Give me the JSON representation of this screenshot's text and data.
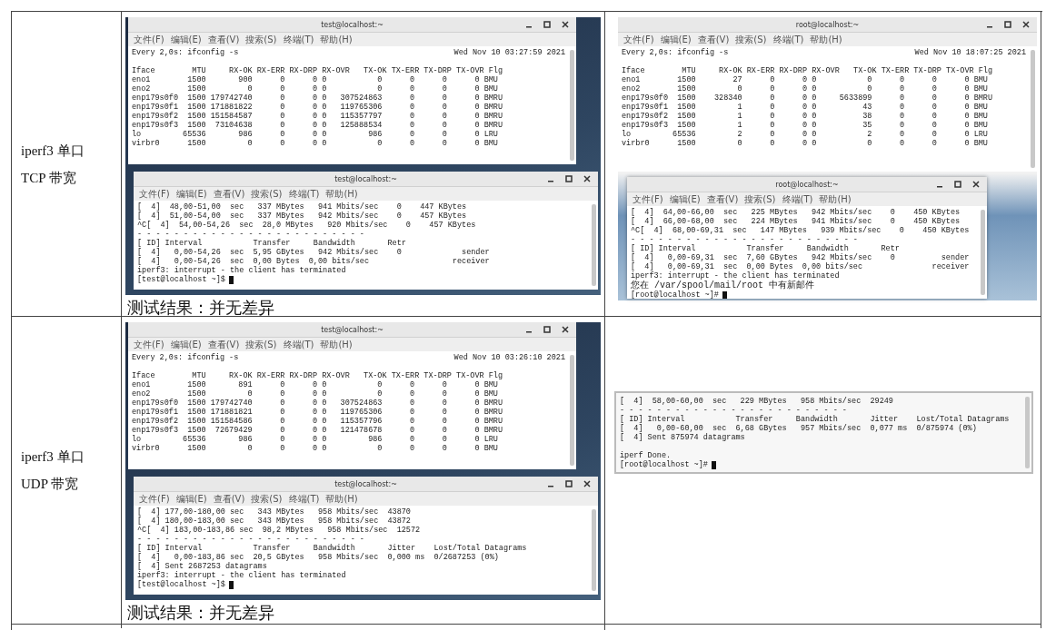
{
  "table": {
    "rows": [
      {
        "label_lines": [
          "iperf3 单口",
          "TCP 带宽"
        ],
        "left": {
          "watch": {
            "title": "test@localhost:~",
            "menu": [
              "文件(F)",
              "编辑(E)",
              "查看(V)",
              "搜索(S)",
              "终端(T)",
              "帮助(H)"
            ],
            "command": "Every 2,0s: ifconfig -s",
            "timestamp": "Wed Nov 10 03:27:59 2021",
            "header": "Iface        MTU     RX-OK RX-ERR RX-DRP RX-OVR   TX-OK TX-ERR TX-DRP TX-OVR Flg",
            "lines": [
              "eno1        1500       900      0      0 0           0      0      0      0 BMU",
              "eno2        1500         0      0      0 0           0      0      0      0 BMU",
              "enp179s0f0  1500 179742740      0      0 0   307524863      0      0      0 BMRU",
              "enp179s0f1  1500 171881822      0      0 0   119765306      0      0      0 BMRU",
              "enp179s0f2  1500 151584587      0      0 0   115357797      0      0      0 BMRU",
              "enp179s0f3  1500  73104638      0      0 0   125888534      0      0      0 BMRU",
              "lo         65536       986      0      0 0         986      0      0      0 LRU",
              "virbr0      1500         0      0      0 0           0      0      0      0 BMU"
            ]
          },
          "iperf": {
            "title": "test@localhost:~",
            "menu": [
              "文件(F)",
              "编辑(E)",
              "查看(V)",
              "搜索(S)",
              "终端(T)",
              "帮助(H)"
            ],
            "lines": [
              "[  4]  48,00-51,00  sec   337 MBytes   941 Mbits/sec    0    447 KBytes",
              "[  4]  51,00-54,00  sec   337 MBytes   942 Mbits/sec    0    457 KBytes",
              "^C[  4]  54,00-54,26  sec  28,0 MBytes   920 Mbits/sec    0    457 KBytes",
              "- - - - - - - - - - - - - - - - - - - - - - - - -",
              "[ ID] Interval           Transfer     Bandwidth       Retr",
              "[  4]   0,00-54,26  sec  5,95 GBytes   942 Mbits/sec    0             sender",
              "[  4]   0,00-54,26  sec  0,00 Bytes  0,00 bits/sec                  receiver",
              "iperf3: interrupt - the client has terminated"
            ],
            "prompt": "[test@localhost ~]$"
          },
          "caption": "测试结果：并无差异"
        },
        "right": {
          "kind": "screenshot",
          "watch": {
            "title": "root@localhost:~",
            "menu": [
              "文件(F)",
              "编辑(E)",
              "查看(V)",
              "搜索(S)",
              "终端(T)",
              "帮助(H)"
            ],
            "command": "Every 2,0s: ifconfig -s",
            "timestamp": "Wed Nov 10 18:07:25 2021",
            "header": "Iface        MTU     RX-OK RX-ERR RX-DRP RX-OVR   TX-OK TX-ERR TX-DRP TX-OVR Flg",
            "lines": [
              "eno1        1500        27      0      0 0           0      0      0      0 BMU",
              "eno2        1500         0      0      0 0           0      0      0      0 BMU",
              "enp179s0f0  1500    328340      0      0 0     5633899      0      0      0 BMRU",
              "enp179s0f1  1500         1      0      0 0          43      0      0      0 BMU",
              "enp179s0f2  1500         1      0      0 0          38      0      0      0 BMU",
              "enp179s0f3  1500         1      0      0 0          35      0      0      0 BMU",
              "lo         65536         2      0      0 0           2      0      0      0 LRU",
              "virbr0      1500         0      0      0 0           0      0      0      0 BMU"
            ]
          },
          "iperf": {
            "title": "root@localhost:~",
            "menu": [
              "文件(F)",
              "编辑(E)",
              "查看(V)",
              "搜索(S)",
              "终端(T)",
              "帮助(H)"
            ],
            "lines": [
              "[  4]  64,00-66,00  sec   225 MBytes   942 Mbits/sec    0    450 KBytes",
              "[  4]  66,00-68,00  sec   224 MBytes   941 Mbits/sec    0    450 KBytes",
              "^C[  4]  68,00-69,31  sec   147 MBytes   939 Mbits/sec    0    450 KBytes",
              "- - - - - - - - - - - - - - - - - - - - - - - - -",
              "[ ID] Interval           Transfer     Bandwidth       Retr",
              "[  4]   0,00-69,31  sec  7,60 GBytes   942 Mbits/sec    0          sender",
              "[  4]   0,00-69,31  sec  0,00 Bytes  0,00 bits/sec               receiver",
              "iperf3: interrupt - the client has terminated"
            ],
            "notice": "您在 /var/spool/mail/root 中有新邮件",
            "prompt": "[root@localhost ~]#"
          }
        }
      },
      {
        "label_lines": [
          "iperf3 单口",
          "UDP 带宽"
        ],
        "left": {
          "watch": {
            "title": "test@localhost:~",
            "menu": [
              "文件(F)",
              "编辑(E)",
              "查看(V)",
              "搜索(S)",
              "终端(T)",
              "帮助(H)"
            ],
            "command": "Every 2,0s: ifconfig -s",
            "timestamp": "Wed Nov 10 03:26:10 2021",
            "header": "Iface        MTU     RX-OK RX-ERR RX-DRP RX-OVR   TX-OK TX-ERR TX-DRP TX-OVR Flg",
            "lines": [
              "eno1        1500       891      0      0 0           0      0      0      0 BMU",
              "eno2        1500         0      0      0 0           0      0      0      0 BMU",
              "enp179s0f0  1500 179742740      0      0 0   307524863      0      0      0 BMRU",
              "enp179s0f1  1500 171881821      0      0 0   119765306      0      0      0 BMRU",
              "enp179s0f2  1500 151584586      0      0 0   115357796      0      0      0 BMRU",
              "enp179s0f3  1500  72679429      0      0 0   121478678      0      0      0 BMRU",
              "lo         65536       986      0      0 0         986      0      0      0 LRU",
              "virbr0      1500         0      0      0 0           0      0      0      0 BMU"
            ]
          },
          "iperf": {
            "title": "test@localhost:~",
            "menu": [
              "文件(F)",
              "编辑(E)",
              "查看(V)",
              "搜索(S)",
              "终端(T)",
              "帮助(H)"
            ],
            "lines": [
              "[  4] 177,00-180,00 sec   343 MBytes   958 Mbits/sec  43870",
              "[  4] 180,00-183,00 sec   343 MBytes   958 Mbits/sec  43872",
              "^C[  4] 183,00-183,86 sec  98,2 MBytes   958 Mbits/sec  12572",
              "- - - - - - - - - - - - - - - - - - - - - - - - -",
              "[ ID] Interval           Transfer     Bandwidth       Jitter    Lost/Total Datagrams",
              "[  4]   0,00-183,86 sec  20,5 GBytes   958 Mbits/sec  0,000 ms  0/2687253 (0%)",
              "[  4] Sent 2687253 datagrams",
              "iperf3: interrupt - the client has terminated"
            ],
            "prompt": "[test@localhost ~]$"
          },
          "caption": "测试结果：并无差异"
        },
        "right": {
          "kind": "fragment",
          "lines": [
            "[  4]  58,00-60,00  sec   229 MBytes   958 Mbits/sec  29249",
            "- - - - - - - - - - - - - - - - - - - - - - - - -",
            "[ ID] Interval           Transfer     Bandwidth       Jitter    Lost/Total Datagrams",
            "[  4]   0,00-60,00  sec  6,68 GBytes   957 Mbits/sec  0,077 ms  0/875974 (0%)",
            "[  4] Sent 875974 datagrams"
          ],
          "done": "iperf Done.",
          "prompt": "[root@localhost ~]#"
        }
      }
    ]
  }
}
